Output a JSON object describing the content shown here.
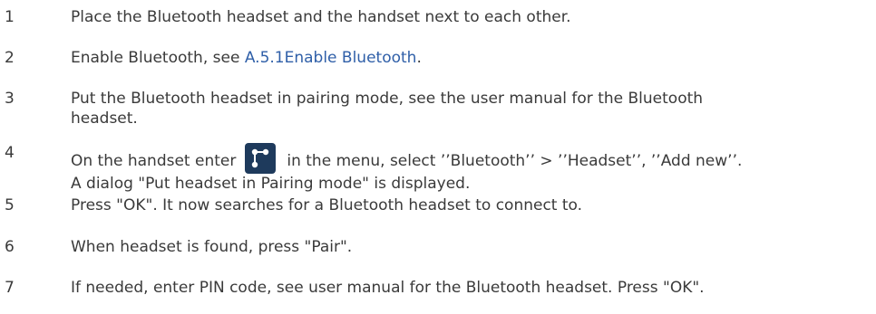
{
  "steps": [
    {
      "number": "1",
      "text": "Place the Bluetooth headset and the handset next to each other."
    },
    {
      "number": "2",
      "text_before": "Enable Bluetooth, see ",
      "link": "A.5.1Enable Bluetooth",
      "text_after": "."
    },
    {
      "number": "3",
      "line1": "Put the Bluetooth headset in pairing mode, see the user manual for the Bluetooth",
      "line2": "headset."
    },
    {
      "number": "4",
      "line1_before": "On the handset enter",
      "icon": "connections-menu-icon",
      "line1_after": "in the menu, select ’’Bluetooth’’ > ’’Headset’’, ’’Add new’’.",
      "line2": "A dialog  \"Put headset in Pairing mode\" is displayed."
    },
    {
      "number": "5",
      "text": "Press \"OK\". It now searches for a Bluetooth headset to connect to."
    },
    {
      "number": "6",
      "text": "When headset is found, press \"Pair\"."
    },
    {
      "number": "7",
      "text": "If needed, enter PIN code, see user manual for the Bluetooth headset. Press \"OK\"."
    }
  ],
  "colors": {
    "text": "#3a3a3a",
    "link": "#2f5fa8",
    "icon_bg": "#1e3a5c"
  }
}
